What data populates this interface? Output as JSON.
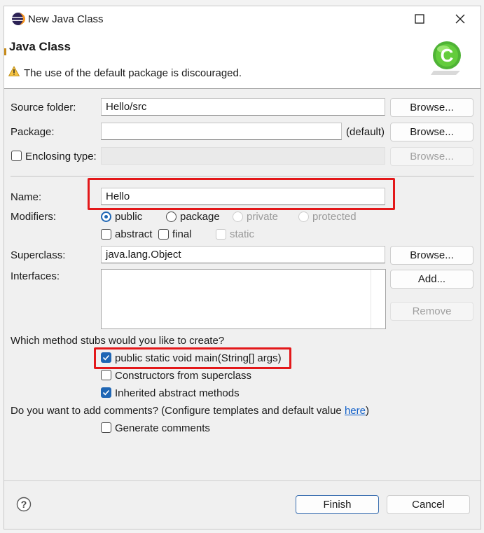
{
  "window": {
    "title": "New Java Class"
  },
  "banner": {
    "title": "Java Class",
    "message": "The use of the default package is discouraged.",
    "logo_icon": "java-class-c-logo-icon"
  },
  "form": {
    "source_folder": {
      "label": "Source folder:",
      "value": "Hello/src",
      "browse": "Browse..."
    },
    "package": {
      "label": "Package:",
      "value": "",
      "default_text": "(default)",
      "browse": "Browse..."
    },
    "enclosing_type": {
      "label": "Enclosing type:",
      "checked": false,
      "value": "",
      "browse": "Browse..."
    },
    "name": {
      "label": "Name:",
      "value": "Hello"
    },
    "modifiers": {
      "label": "Modifiers:",
      "radios": [
        {
          "label": "public",
          "checked": true,
          "enabled": true
        },
        {
          "label": "package",
          "checked": false,
          "enabled": true
        },
        {
          "label": "private",
          "checked": false,
          "enabled": false
        },
        {
          "label": "protected",
          "checked": false,
          "enabled": false
        }
      ],
      "checks": [
        {
          "label": "abstract",
          "checked": false,
          "enabled": true
        },
        {
          "label": "final",
          "checked": false,
          "enabled": true
        },
        {
          "label": "static",
          "checked": false,
          "enabled": false
        }
      ]
    },
    "superclass": {
      "label": "Superclass:",
      "value": "java.lang.Object",
      "browse": "Browse..."
    },
    "interfaces": {
      "label": "Interfaces:",
      "add": "Add...",
      "remove": "Remove"
    },
    "stubs": {
      "question": "Which method stubs would you like to create?",
      "options": [
        {
          "label": "public static void main(String[] args)",
          "checked": true
        },
        {
          "label": "Constructors from superclass",
          "checked": false
        },
        {
          "label": "Inherited abstract methods",
          "checked": true
        }
      ]
    },
    "comments": {
      "question": "Do you want to add comments? (Configure templates and default value ",
      "link": "here",
      "question_end": ")",
      "option": {
        "label": "Generate comments",
        "checked": false
      }
    }
  },
  "footer": {
    "finish": "Finish",
    "cancel": "Cancel"
  },
  "colors": {
    "highlight": "#e3181a",
    "checkbox_checked": "#1f66b4",
    "link": "#1160c9"
  }
}
